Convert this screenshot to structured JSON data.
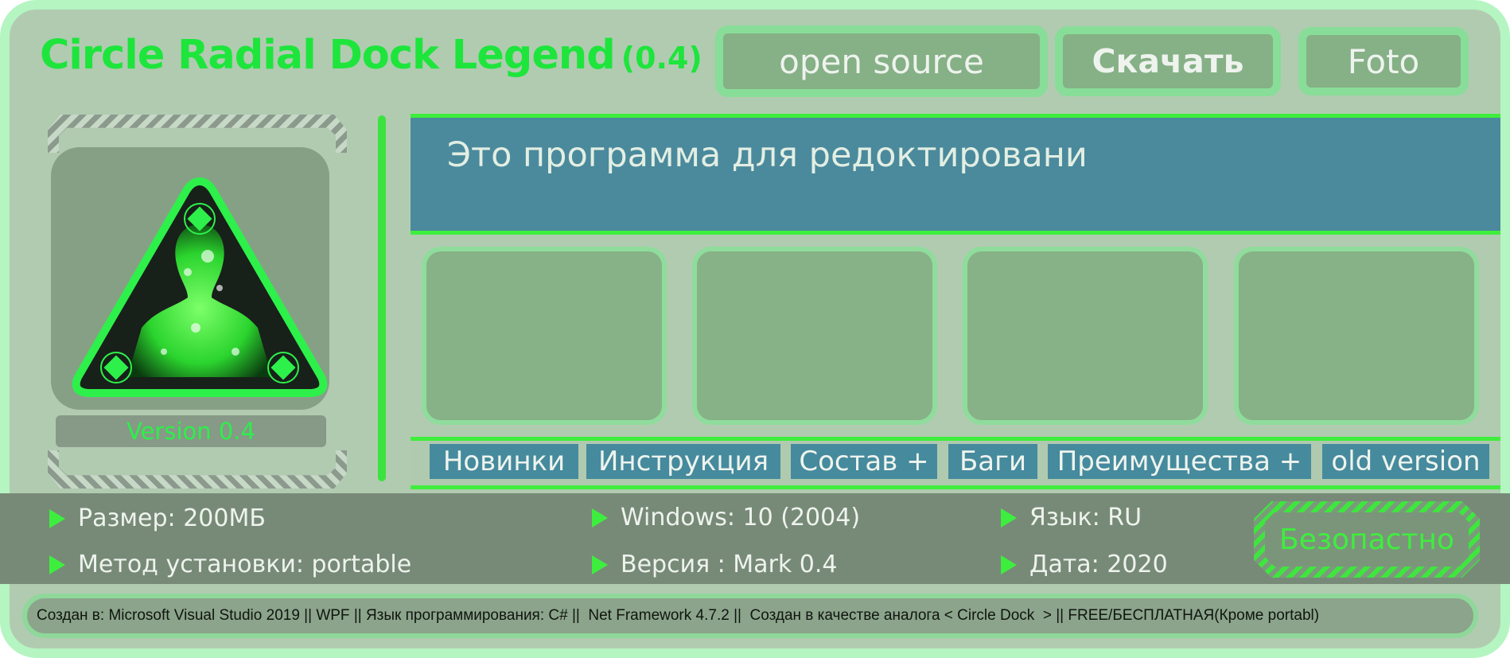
{
  "header": {
    "title": "Circle Radial Dock Legend",
    "version": "(0.4)",
    "buttons": {
      "open_source": "open source",
      "download": "Скачать",
      "foto": "Foto"
    }
  },
  "sidebar": {
    "version_label": "Version 0.4"
  },
  "description": {
    "text": "Это программа для редоктировани"
  },
  "tabs": [
    "Новинки",
    "Инструкция",
    "Состав +",
    "Баги",
    "Преимущества  +",
    "old version"
  ],
  "info": {
    "size": "Размер: 200МБ",
    "install_method": "Метод установки: portable",
    "windows": "Windows: 10 (2004)",
    "version": "Версия : Mark 0.4",
    "language": "Язык: RU",
    "date": "Дата: 2020",
    "safe_badge": "Безопастно"
  },
  "footer": {
    "text": "Создан в: Microsoft Visual Studio 2019 || WPF || Язык программирования: C# ||  Net Framework 4.7.2 ||  Создан в качестве аналога < Circle Dock  > || FREE/БЕСПЛАТНАЯ(Кроме portabl)"
  },
  "colors": {
    "accent_green": "#1ee53c",
    "panel_blue": "#4a8a9c",
    "background": "#b1cbb1"
  },
  "icons": [
    "triangle-avatar-icon",
    "play-bullet-icon"
  ]
}
